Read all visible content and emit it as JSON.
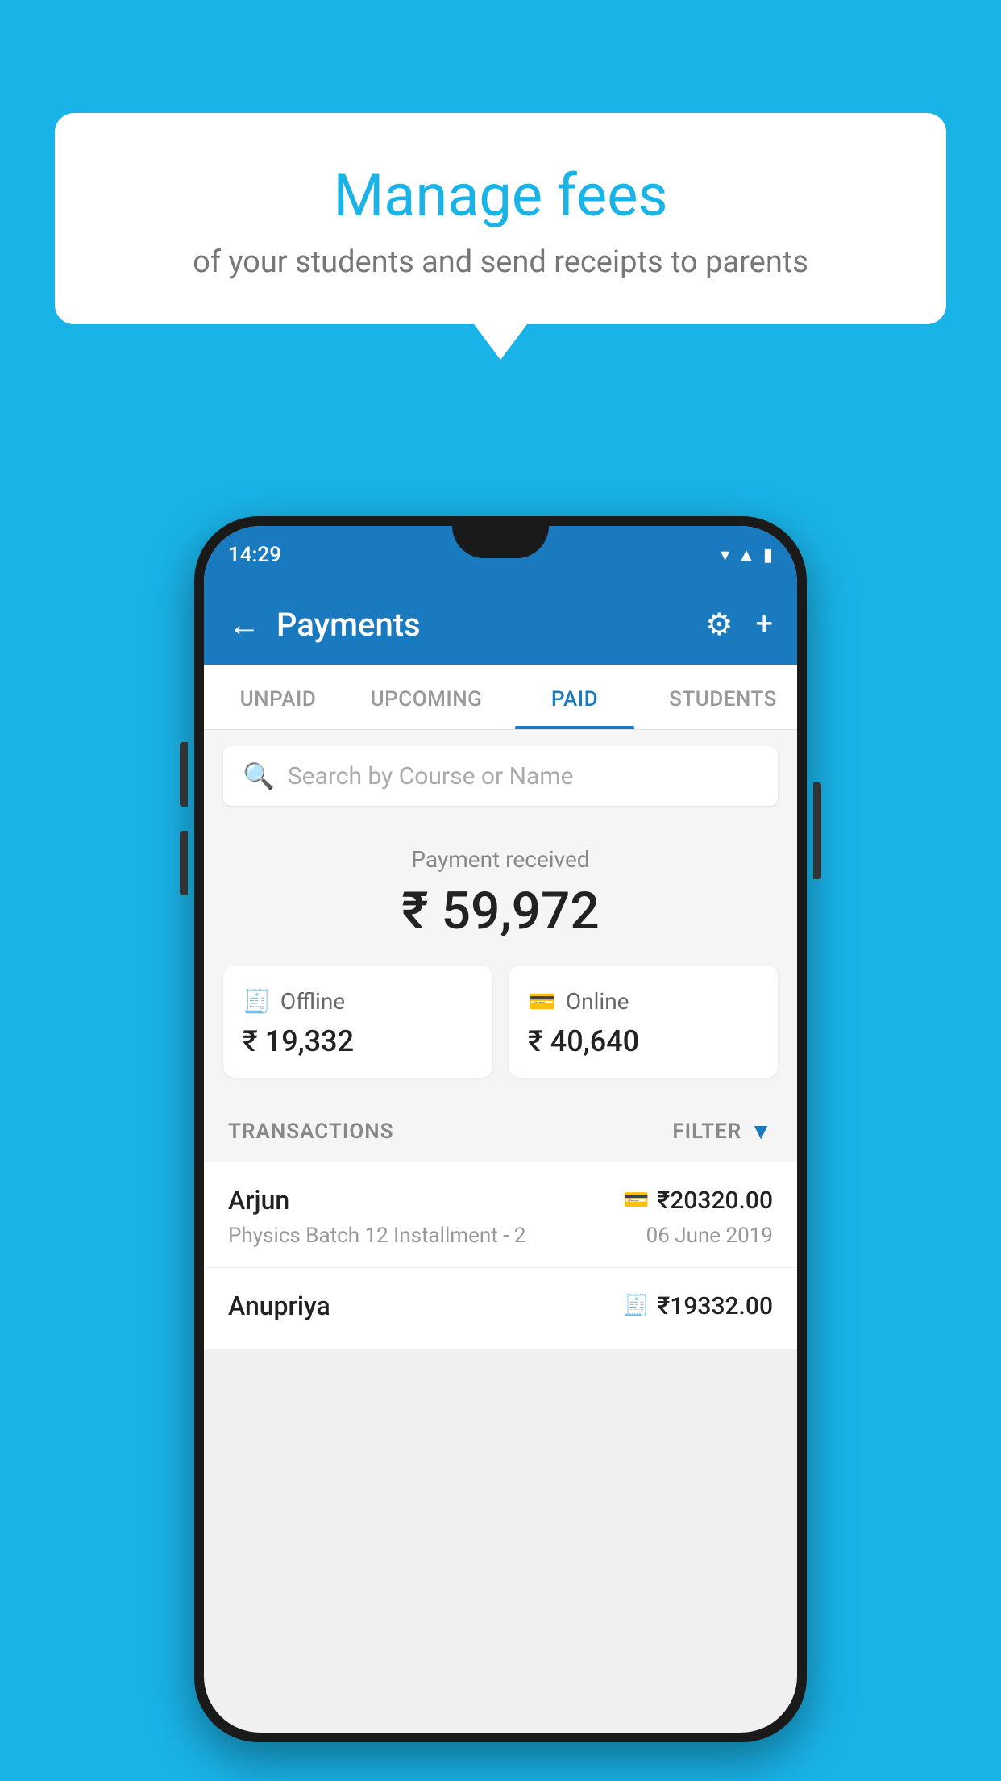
{
  "background_color": "#1ab3e8",
  "speech_bubble": {
    "title": "Manage fees",
    "subtitle": "of your students and send receipts to parents"
  },
  "phone": {
    "status_bar": {
      "time": "14:29"
    },
    "app_bar": {
      "title": "Payments",
      "back_label": "←",
      "settings_icon": "⚙",
      "add_icon": "+"
    },
    "tabs": [
      {
        "label": "UNPAID",
        "active": false
      },
      {
        "label": "UPCOMING",
        "active": false
      },
      {
        "label": "PAID",
        "active": true
      },
      {
        "label": "STUDENTS",
        "active": false
      }
    ],
    "search": {
      "placeholder": "Search by Course or Name"
    },
    "payment_summary": {
      "label": "Payment received",
      "amount": "₹ 59,972",
      "offline_label": "Offline",
      "offline_amount": "₹ 19,332",
      "online_label": "Online",
      "online_amount": "₹ 40,640"
    },
    "transactions": {
      "section_label": "TRANSACTIONS",
      "filter_label": "FILTER",
      "items": [
        {
          "name": "Arjun",
          "course": "Physics Batch 12 Installment - 2",
          "date": "06 June 2019",
          "amount": "₹20320.00",
          "payment_type": "online"
        },
        {
          "name": "Anupriya",
          "course": "",
          "date": "",
          "amount": "₹19332.00",
          "payment_type": "offline"
        }
      ]
    }
  }
}
